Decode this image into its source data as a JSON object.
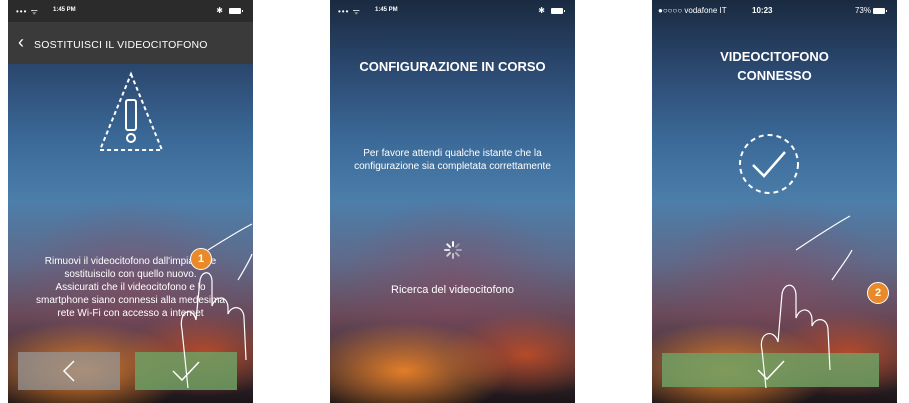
{
  "screen1": {
    "status": {
      "signal": "••• ",
      "time": "1:45 PM",
      "bluetooth": "✱"
    },
    "nav": {
      "back_icon": "‹",
      "title": "SOSTITUISCI IL VIDEOCITOFONO"
    },
    "instructions": [
      "Rimuovi il videocitofono dall'impianto e",
      "sostituiscilo con quello nuovo.",
      "Assicurati che il videocitofono e lo",
      "smartphone siano connessi alla medesima",
      "rete Wi-Fi con accesso a internet"
    ],
    "step_badge": "1",
    "icons": {
      "warning": "warning-icon",
      "back": "chevron-left-icon",
      "confirm": "checkmark-icon"
    }
  },
  "screen2": {
    "status": {
      "signal": "••• ",
      "time": "1:45 PM",
      "bluetooth": "✱"
    },
    "title": "CONFIGURAZIONE IN CORSO",
    "message": [
      "Per favore attendi qualche istante che la",
      "configurazione sia completata correttamente"
    ],
    "searching": "Ricerca del videocitofono",
    "icons": {
      "spinner": "loading-spinner-icon"
    }
  },
  "screen3": {
    "status": {
      "carrier": "●○○○○ vodafone IT",
      "time": "10:23",
      "battery": "73%"
    },
    "title_lines": [
      "VIDEOCITOFONO",
      "CONNESSO"
    ],
    "step_badge": "2",
    "icons": {
      "success": "checkmark-circle-icon",
      "confirm": "checkmark-icon"
    }
  },
  "colors": {
    "accent_green": "#6ea064",
    "badge_orange": "#e98a2a",
    "nav_dark": "#3a3a3a"
  }
}
